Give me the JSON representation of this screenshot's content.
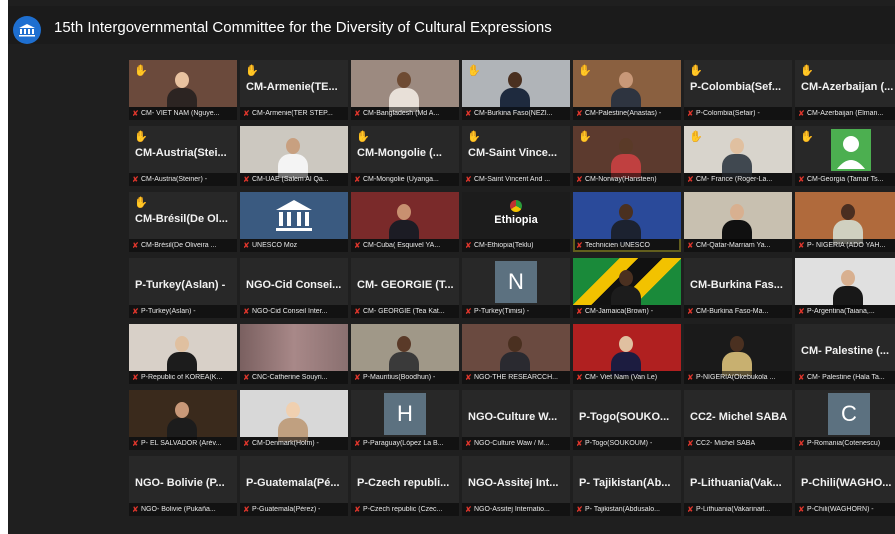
{
  "app": {
    "title": "15th Intergovernmental Committee for the Diversity of Cultural Expressions"
  },
  "participants": [
    {
      "name": "CM- VIET NAM (Nguye...",
      "big": "",
      "hand": true,
      "video": true,
      "bg": "#6b4a3c",
      "skin": "#e8c2a0",
      "cloth": "#2c2422"
    },
    {
      "name": "CM-Armenie(TER STEP...",
      "big": "CM-Armenie(TE...",
      "hand": true,
      "video": false
    },
    {
      "name": "CM-Bangladesh (Md A...",
      "big": "",
      "hand": false,
      "video": true,
      "bg": "#9c8a80",
      "skin": "#6e4b33",
      "cloth": "#e8e0d8"
    },
    {
      "name": "CM-Burkina Faso(NEZI...",
      "big": "",
      "hand": true,
      "video": true,
      "bg": "#b0b4b8",
      "skin": "#4a3020",
      "cloth": "#1e2a3e"
    },
    {
      "name": "CM-Palestine(Anastas) -",
      "big": "",
      "hand": true,
      "video": true,
      "bg": "#8a6040",
      "skin": "#c89878",
      "cloth": "#2e3440"
    },
    {
      "name": "P-Colombia(Sefair) -",
      "big": "P-Colombia(Sef...",
      "hand": true,
      "video": false
    },
    {
      "name": "CM-Azerbaijan (Elman...",
      "big": "CM-Azerbaijan (...",
      "hand": true,
      "video": false
    },
    {
      "name": "CM-Austria(Steiner) -",
      "big": "CM-Austria(Stei...",
      "hand": true,
      "video": false
    },
    {
      "name": "CM-UAE (Salem Al Qa...",
      "big": "",
      "hand": false,
      "video": true,
      "bg": "#ccc8c0",
      "skin": "#c8a080",
      "cloth": "#f4f4f4"
    },
    {
      "name": "CM-Mongolie (Uyanga...",
      "big": "CM-Mongolie (...",
      "hand": true,
      "video": false
    },
    {
      "name": "CM-Saint Vincent And ...",
      "big": "CM-Saint Vince...",
      "hand": true,
      "video": false
    },
    {
      "name": "CM-Norway(Hansteen)",
      "big": "",
      "hand": true,
      "video": true,
      "bg": "#5c3a2e",
      "skin": "#5a3a28",
      "cloth": "#c04040"
    },
    {
      "name": "CM- France (Roger-La...",
      "big": "",
      "hand": true,
      "video": true,
      "bg": "#d8d4cc",
      "skin": "#e0c0a0",
      "cloth": "#404850"
    },
    {
      "name": "CM-Georgia (Tamar Ts...",
      "big": "",
      "hand": true,
      "video": false,
      "avatar": true
    },
    {
      "name": "CM-Brésil(De Oliveira ...",
      "big": "CM-Brésil(De Ol...",
      "hand": true,
      "video": false
    },
    {
      "name": "UNESCO Moz",
      "big": "",
      "hand": false,
      "video": true,
      "bg": "#3a5a80",
      "unesco": true
    },
    {
      "name": "CM-Cuba( Esquivel YA...",
      "big": "",
      "hand": false,
      "video": true,
      "bg": "#7a2a2a",
      "skin": "#c89070",
      "cloth": "#1c1c24"
    },
    {
      "name": "CM-Ethiopia(Teklu)",
      "big": "",
      "hand": false,
      "video": true,
      "bg": "#1c1c1c",
      "ethiopia": "Ethiopia"
    },
    {
      "name": "Technicien UNESCO",
      "big": "",
      "hand": false,
      "video": true,
      "bg": "#2a4a9a",
      "skin": "#4a3020",
      "cloth": "#1c2230",
      "active": true
    },
    {
      "name": "CM-Qatar-Marriam Ya...",
      "big": "",
      "hand": false,
      "video": true,
      "bg": "#c8c0b0",
      "skin": "#d8b090",
      "cloth": "#101010"
    },
    {
      "name": "P- NIGERIA (ADO YAH...",
      "big": "",
      "hand": false,
      "video": true,
      "bg": "#b06a3c",
      "skin": "#4a2e20",
      "cloth": "#d0d0c0"
    },
    {
      "name": "P-Turkey(Aslan) -",
      "big": "P-Turkey(Aslan) -",
      "hand": false,
      "video": false
    },
    {
      "name": "NGO-Cid Conseil Inter...",
      "big": "NGO-Cid Consei...",
      "hand": false,
      "video": false
    },
    {
      "name": "CM- GEORGIE (Tea Kat...",
      "big": "CM- GEORGIE (T...",
      "hand": false,
      "video": false
    },
    {
      "name": "P-Turkey(Timisi) -",
      "big": "",
      "hand": false,
      "video": false,
      "initial": "N"
    },
    {
      "name": "CM-Jamaica(Brown) -",
      "big": "",
      "hand": false,
      "video": true,
      "bg": "#1a7a3a",
      "skin": "#4a3020",
      "cloth": "#1c1c1c",
      "jamaica": true
    },
    {
      "name": "CM-Burkina Faso-Ma...",
      "big": "CM-Burkina Fas...",
      "hand": false,
      "video": false
    },
    {
      "name": "P-Argentina(Taiana,...",
      "big": "",
      "hand": false,
      "video": true,
      "bg": "#e0e0e0",
      "skin": "#d8b090",
      "cloth": "#181818"
    },
    {
      "name": "P-Republic of KOREA(K...",
      "big": "",
      "hand": false,
      "video": true,
      "bg": "#d8d0c8",
      "skin": "#e0c0a0",
      "cloth": "#1c1c1c"
    },
    {
      "name": "CNC-Catherine Souyri...",
      "big": "",
      "hand": false,
      "video": true,
      "bg": "#9a8080",
      "blur": true
    },
    {
      "name": "P-Mauritius(Boodhun) -",
      "big": "",
      "hand": false,
      "video": true,
      "bg": "#a09888",
      "skin": "#5a3a28",
      "cloth": "#3a3a3a"
    },
    {
      "name": "NGO-THE RESEARCCH...",
      "big": "",
      "hand": false,
      "video": true,
      "bg": "#6a4a40",
      "skin": "#4a3020",
      "cloth": "#2a2a30"
    },
    {
      "name": "CM- Viet Nam (Van Le)",
      "big": "",
      "hand": false,
      "video": true,
      "bg": "#b02020",
      "skin": "#e0c0a0",
      "cloth": "#1c1c40"
    },
    {
      "name": "P-NIGERIA(Okebukola ...",
      "big": "",
      "hand": false,
      "video": true,
      "bg": "#1a1a1a",
      "skin": "#4a3020",
      "cloth": "#c8b070"
    },
    {
      "name": "CM- Palestine (Hala Ta...",
      "big": "CM- Palestine (...",
      "hand": false,
      "video": false
    },
    {
      "name": "P- EL SALVADOR (Arév...",
      "big": "",
      "hand": false,
      "video": true,
      "bg": "#3a2a1c",
      "skin": "#c89878",
      "cloth": "#1c1c1c"
    },
    {
      "name": "CM-Denmark(Holm) -",
      "big": "",
      "hand": false,
      "video": true,
      "bg": "#d8d8d8",
      "skin": "#f0d0b0",
      "cloth": "#c0a080"
    },
    {
      "name": "P-Paraguay(López La B...",
      "big": "",
      "hand": false,
      "video": false,
      "initial": "H"
    },
    {
      "name": "NGO-Culture Waw / M...",
      "big": "NGO-Culture W...",
      "hand": false,
      "video": false
    },
    {
      "name": "P-Togo(SOUKOUM) -",
      "big": "P-Togo(SOUKO...",
      "hand": false,
      "video": false
    },
    {
      "name": "CC2- Michel SABA",
      "big": "CC2- Michel SABA",
      "hand": false,
      "video": false
    },
    {
      "name": "P-Romania(Cotenescu)",
      "big": "",
      "hand": false,
      "video": false,
      "initial": "C"
    },
    {
      "name": "NGO- Bolivie (Pukaña...",
      "big": "NGO- Bolivie (P...",
      "hand": false,
      "video": false
    },
    {
      "name": "P-Guatemala(Pérez) -",
      "big": "P-Guatemala(Pé...",
      "hand": false,
      "video": false
    },
    {
      "name": "P-Czech republic (Czec...",
      "big": "P-Czech republi...",
      "hand": false,
      "video": false
    },
    {
      "name": "NGO-Assitej Internatio...",
      "big": "NGO-Assitej Int...",
      "hand": false,
      "video": false
    },
    {
      "name": "P- Tajikistan(Abdusalo...",
      "big": "P- Tajikistan(Ab...",
      "hand": false,
      "video": false
    },
    {
      "name": "P-Lithuania(Vakarinait...",
      "big": "P-Lithuania(Vak...",
      "hand": false,
      "video": false
    },
    {
      "name": "P-Chili(WAGHORN) -",
      "big": "P-Chili(WAGHO...",
      "hand": false,
      "video": false
    }
  ]
}
